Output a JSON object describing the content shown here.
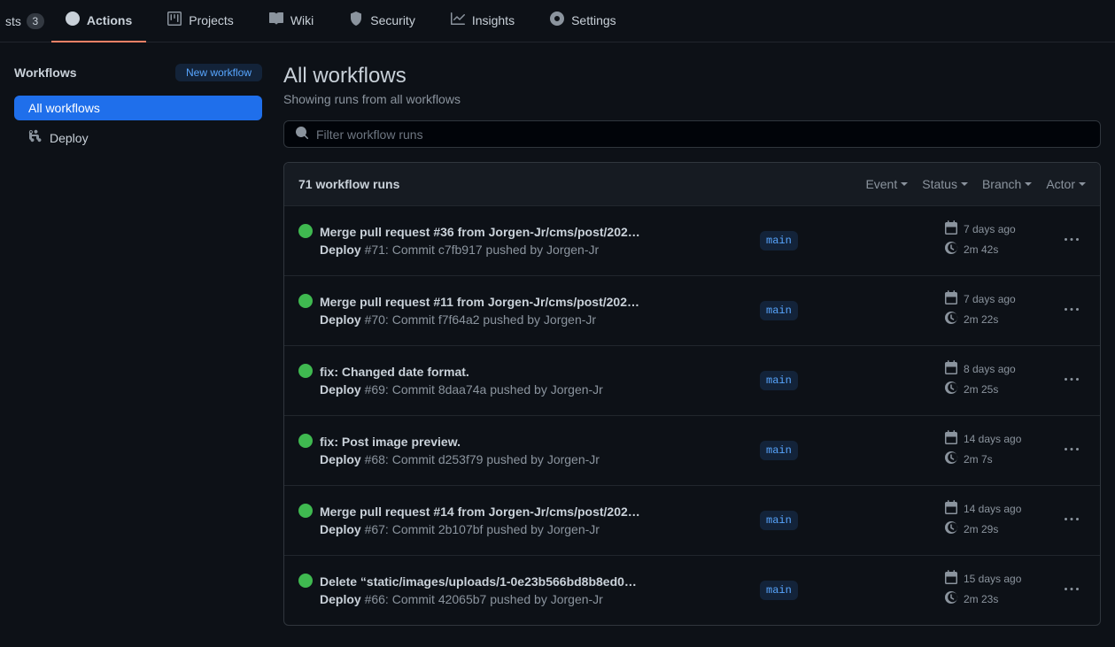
{
  "nav": {
    "pull_requests_partial": "sts",
    "pr_count": "3",
    "actions": "Actions",
    "projects": "Projects",
    "wiki": "Wiki",
    "security": "Security",
    "insights": "Insights",
    "settings": "Settings"
  },
  "sidebar": {
    "title": "Workflows",
    "new_workflow": "New workflow",
    "all_workflows": "All workflows",
    "deploy": "Deploy"
  },
  "main": {
    "title": "All workflows",
    "subtitle": "Showing runs from all workflows",
    "search_placeholder": "Filter workflow runs",
    "runs_count": "71 workflow runs",
    "filters": {
      "event": "Event",
      "status": "Status",
      "branch": "Branch",
      "actor": "Actor"
    }
  },
  "runs": [
    {
      "title": "Merge pull request #36 from Jorgen-Jr/cms/post/202…",
      "workflow": "Deploy",
      "sub": "#71: Commit c7fb917 pushed by Jorgen-Jr",
      "branch": "main",
      "date": "7 days ago",
      "duration": "2m 42s"
    },
    {
      "title": "Merge pull request #11 from Jorgen-Jr/cms/post/202…",
      "workflow": "Deploy",
      "sub": "#70: Commit f7f64a2 pushed by Jorgen-Jr",
      "branch": "main",
      "date": "7 days ago",
      "duration": "2m 22s"
    },
    {
      "title": "fix: Changed date format.",
      "workflow": "Deploy",
      "sub": "#69: Commit 8daa74a pushed by Jorgen-Jr",
      "branch": "main",
      "date": "8 days ago",
      "duration": "2m 25s"
    },
    {
      "title": "fix: Post image preview.",
      "workflow": "Deploy",
      "sub": "#68: Commit d253f79 pushed by Jorgen-Jr",
      "branch": "main",
      "date": "14 days ago",
      "duration": "2m 7s"
    },
    {
      "title": "Merge pull request #14 from Jorgen-Jr/cms/post/202…",
      "workflow": "Deploy",
      "sub": "#67: Commit 2b107bf pushed by Jorgen-Jr",
      "branch": "main",
      "date": "14 days ago",
      "duration": "2m 29s"
    },
    {
      "title": "Delete “static/images/uploads/1-0e23b566bd8b8ed0…",
      "workflow": "Deploy",
      "sub": "#66: Commit 42065b7 pushed by Jorgen-Jr",
      "branch": "main",
      "date": "15 days ago",
      "duration": "2m 23s"
    }
  ]
}
